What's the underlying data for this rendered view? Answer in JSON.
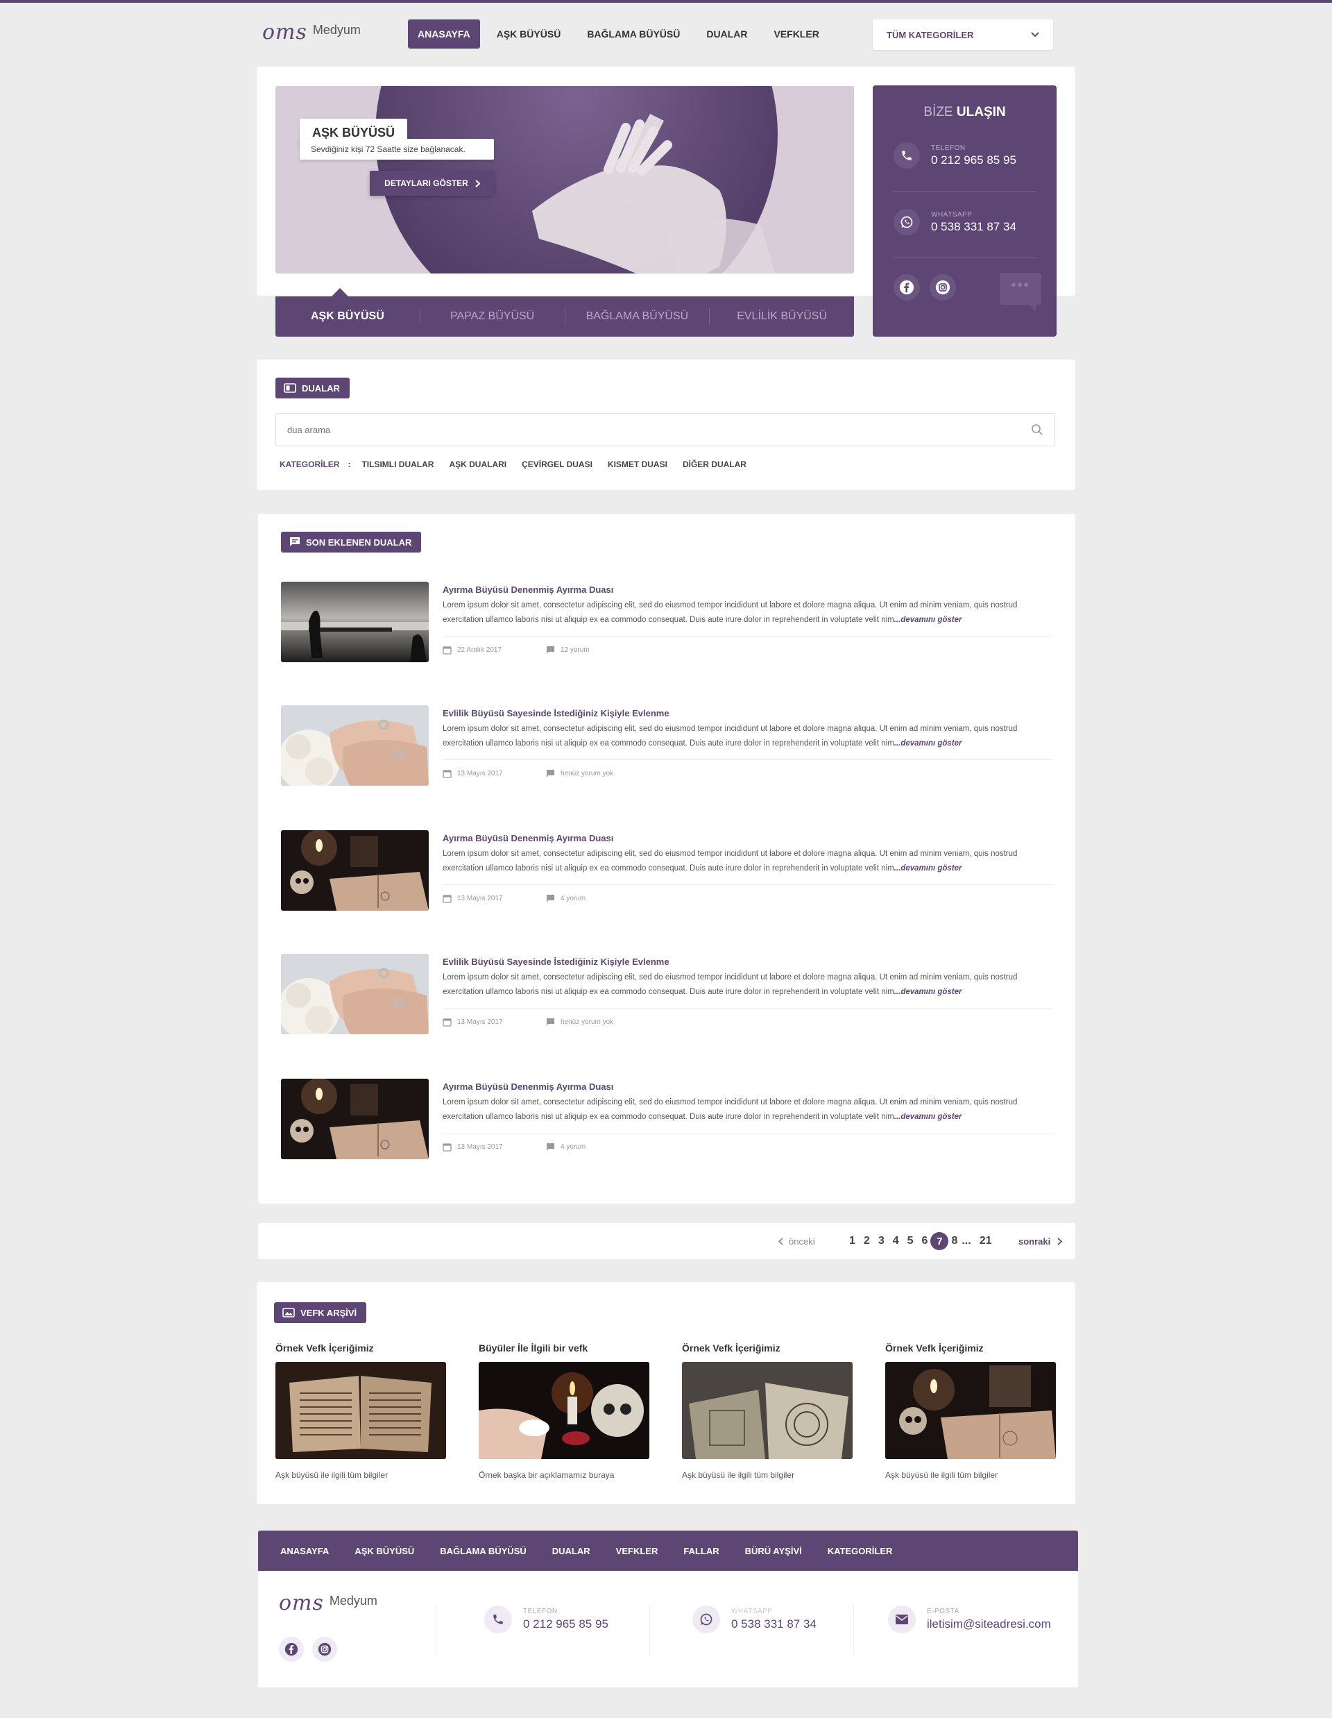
{
  "header": {
    "logo_mark": "oms",
    "logo_word": "Medyum",
    "nav": [
      "ANASAYFA",
      "AŞK BÜYÜSÜ",
      "BAĞLAMA BÜYÜSÜ",
      "DUALAR",
      "VEFKLER"
    ],
    "category_select": "TÜM KATEGORİLER"
  },
  "hero": {
    "label": "AŞK BÜYÜSÜ",
    "subtitle": "Sevdiğiniz kişi 72 Saatte size bağlanacak.",
    "button": "DETAYLARI GÖSTER",
    "tabs": [
      "AŞK BÜYÜSÜ",
      "PAPAZ BÜYÜSÜ",
      "BAĞLAMA BÜYÜSÜ",
      "EVLİLİK BÜYÜSÜ"
    ]
  },
  "contact": {
    "title_light": "BİZE",
    "title_bold": "ULAŞIN",
    "phone_label": "TELEFON",
    "phone": "0 212 965 85 95",
    "whatsapp_label": "WHATSAPP",
    "whatsapp": "0 538 331 87 34",
    "chat": "•••"
  },
  "dualar": {
    "badge": "DUALAR",
    "search_placeholder": "dua arama",
    "categories_label": "KATEGORİLER",
    "colon": ":",
    "categories": [
      "TILSIMLI DUALAR",
      "AŞK DUALARI",
      "ÇEVİRGEL DUASI",
      "KISMET DUASI",
      "DİĞER DUALAR"
    ]
  },
  "recent": {
    "badge": "SON EKLENEN DUALAR",
    "more_label": "...devamını göster",
    "posts": [
      {
        "title": "Ayırma Büyüsü Denenmiş Ayırma Duası",
        "desc": "Lorem ipsum dolor sit amet, consectetur adipiscing elit, sed do eiusmod tempor incididunt ut labore et dolore magna aliqua. Ut enim ad minim veniam, quis nostrud exercitation ullamco laboris nisi ut aliquip ex ea commodo consequat. Duis aute irure dolor in reprehenderit in voluptate velit nim",
        "date": "22 Aralık 2017",
        "comments": "12 yorum"
      },
      {
        "title": "Evlilik Büyüsü Sayesinde İstediğiniz Kişiyle Evlenme",
        "desc": "Lorem ipsum dolor sit amet, consectetur adipiscing elit, sed do eiusmod tempor incididunt ut labore et dolore magna aliqua. Ut enim ad minim veniam, quis nostrud exercitation ullamco laboris nisi ut aliquip ex ea commodo consequat. Duis aute irure dolor in reprehenderit in voluptate velit nim",
        "date": "13 Mayıs 2017",
        "comments": "henüz yorum yok"
      },
      {
        "title": "Ayırma Büyüsü Denenmiş Ayırma Duası",
        "desc": "Lorem ipsum dolor sit amet, consectetur adipiscing elit, sed do eiusmod tempor incididunt ut labore et dolore magna aliqua. Ut enim ad minim veniam, quis nostrud exercitation ullamco laboris nisi ut aliquip ex ea commodo consequat. Duis aute irure dolor in reprehenderit in voluptate velit nim",
        "date": "13 Mayıs 2017",
        "comments": "4 yorum"
      },
      {
        "title": "Evlilik Büyüsü Sayesinde İstediğiniz Kişiyle Evlenme",
        "desc": "Lorem ipsum dolor sit amet, consectetur adipiscing elit, sed do eiusmod tempor incididunt ut labore et dolore magna aliqua. Ut enim ad minim veniam, quis nostrud exercitation ullamco laboris nisi ut aliquip ex ea commodo consequat. Duis aute irure dolor in reprehenderit in voluptate velit nim",
        "date": "13 Mayıs 2017",
        "comments": "henüz yorum yok"
      },
      {
        "title": "Ayırma Büyüsü Denenmiş Ayırma Duası",
        "desc": "Lorem ipsum dolor sit amet, consectetur adipiscing elit, sed do eiusmod tempor incididunt ut labore et dolore magna aliqua. Ut enim ad minim veniam, quis nostrud exercitation ullamco laboris nisi ut aliquip ex ea commodo consequat. Duis aute irure dolor in reprehenderit in voluptate velit nim",
        "date": "13 Mayıs 2017",
        "comments": "4 yorum"
      }
    ]
  },
  "pagination": {
    "prev": "önceki",
    "next": "sonraki",
    "pages": [
      "1",
      "2",
      "3",
      "4",
      "5",
      "6"
    ],
    "current": "7",
    "after": "8",
    "ellipsis": "...",
    "last": "21"
  },
  "vefk": {
    "badge": "VEFK ARŞİVİ",
    "items": [
      {
        "title": "Örnek Vefk İçeriğimiz",
        "desc": "Aşk büyüsü ile ilgili tüm bilgiler"
      },
      {
        "title": "Büyüler İle İlgili bir vefk",
        "desc": "Örnek başka bir açıklamamız buraya"
      },
      {
        "title": "Örnek Vefk İçeriğimiz",
        "desc": "Aşk büyüsü ile ilgili tüm bilgiler"
      },
      {
        "title": "Örnek Vefk İçeriğimiz",
        "desc": "Aşk büyüsü ile ilgili tüm bilgiler"
      }
    ]
  },
  "footer": {
    "nav": [
      "ANASAYFA",
      "AŞK BÜYÜSÜ",
      "BAĞLAMA BÜYÜSÜ",
      "DUALAR",
      "VEFKLER",
      "FALLAR",
      "BÜRÜ AYŞİVİ",
      "KATEGORİLER"
    ],
    "phone_label": "TELEFON",
    "phone": "0 212 965 85 95",
    "whatsapp_label": "WHATSAPP",
    "whatsapp": "0 538 331 87 34",
    "email_label": "E-POSTA",
    "email": "iletisim@siteadresi.com"
  },
  "colors": {
    "accent": "#5e4674",
    "background": "#ececec",
    "panel": "#ffffff"
  },
  "icons": [
    "chevron-down-icon",
    "chevron-right-icon",
    "phone-icon",
    "whatsapp-icon",
    "facebook-icon",
    "instagram-icon",
    "search-icon",
    "calendar-icon",
    "comment-icon",
    "book-icon",
    "image-icon",
    "mail-icon",
    "chevron-left-icon"
  ]
}
